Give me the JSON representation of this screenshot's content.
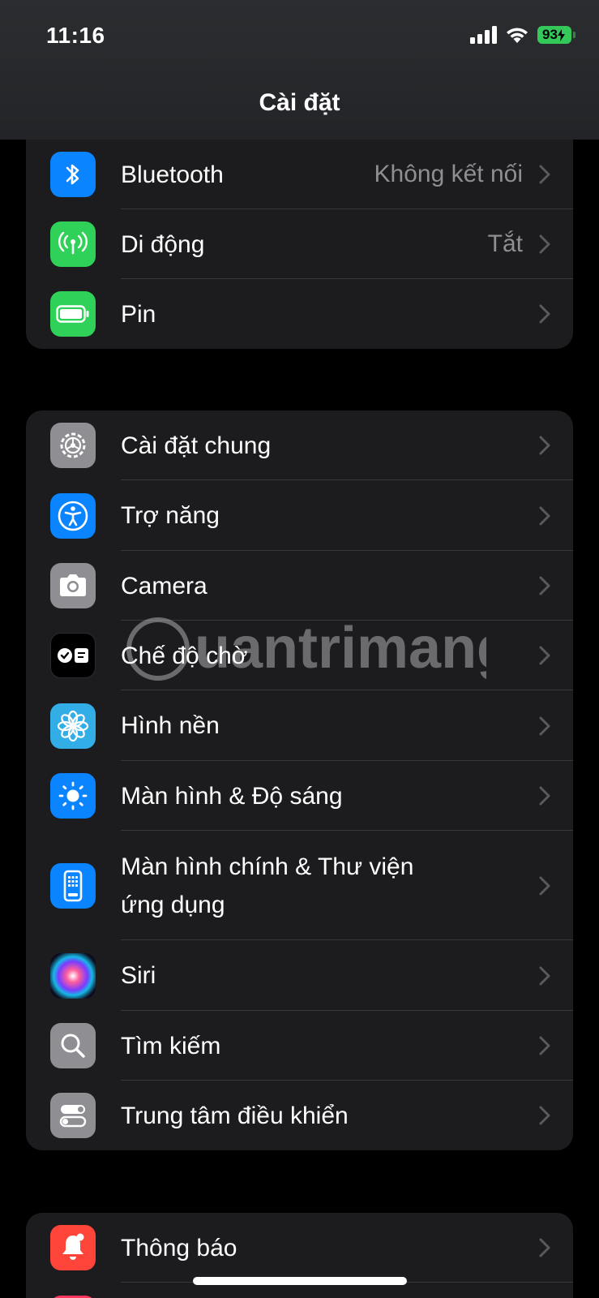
{
  "status": {
    "time": "11:16",
    "battery": "93"
  },
  "nav": {
    "title": "Cài đặt"
  },
  "groups": [
    {
      "rows": [
        {
          "label": "Bluetooth",
          "value": "Không kết nối",
          "icon": "bluetooth-icon",
          "color": "#0a84ff"
        },
        {
          "label": "Di động",
          "value": "Tắt",
          "icon": "cellular-icon",
          "color": "#30d158"
        },
        {
          "label": "Pin",
          "icon": "battery-icon",
          "color": "#30d158"
        }
      ]
    },
    {
      "rows": [
        {
          "label": "Cài đặt chung",
          "icon": "gear-icon",
          "color": "#8e8e93"
        },
        {
          "label": "Trợ năng",
          "icon": "accessibility-icon",
          "color": "#0a84ff"
        },
        {
          "label": "Camera",
          "icon": "camera-icon",
          "color": "#8e8e93"
        },
        {
          "label": "Chế độ chờ",
          "icon": "standby-icon",
          "color": "#000000"
        },
        {
          "label": "Hình nền",
          "icon": "wallpaper-flower-icon",
          "color": "#32ade6"
        },
        {
          "label": "Màn hình & Độ sáng",
          "icon": "brightness-icon",
          "color": "#0a84ff"
        },
        {
          "label": "Màn hình chính & Thư viện ứng dụng",
          "icon": "home-screen-icon",
          "color": "#0a84ff"
        },
        {
          "label": "Siri",
          "icon": "siri-icon",
          "color": "#1a1a2e"
        },
        {
          "label": "Tìm kiếm",
          "icon": "search-icon",
          "color": "#8e8e93"
        },
        {
          "label": "Trung tâm điều khiển",
          "icon": "control-center-icon",
          "color": "#8e8e93"
        }
      ]
    },
    {
      "rows": [
        {
          "label": "Thông báo",
          "icon": "bell-icon",
          "color": "#ff453a"
        }
      ]
    }
  ],
  "watermark": {
    "text": "uantrimang"
  }
}
